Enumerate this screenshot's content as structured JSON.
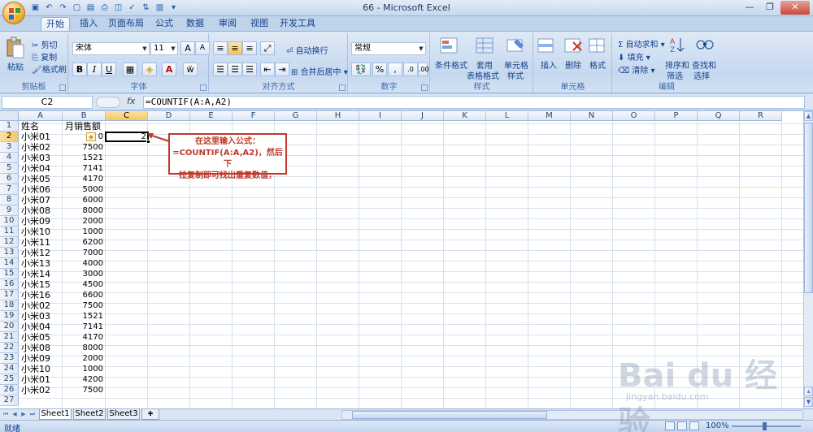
{
  "window": {
    "title": "66 - Microsoft Excel"
  },
  "ribbon_tabs": [
    "开始",
    "插入",
    "页面布局",
    "公式",
    "数据",
    "审阅",
    "视图",
    "开发工具"
  ],
  "clipboard": {
    "paste": "粘贴",
    "cut": "剪切",
    "copy": "复制",
    "format_painter": "格式刷",
    "label": "剪贴板"
  },
  "font": {
    "name": "宋体",
    "size": "11",
    "label": "字体",
    "bold": "B",
    "italic": "I",
    "underline": "U",
    "grow": "A",
    "shrink": "A"
  },
  "alignment": {
    "wrap": "自动换行",
    "merge": "合并后居中",
    "label": "对齐方式"
  },
  "number": {
    "format": "常规",
    "percent": "%",
    "comma": ",",
    "label": "数字"
  },
  "styles": {
    "conditional": "条件格式",
    "table_format_1": "套用",
    "table_format_2": "表格格式",
    "cell_styles_1": "单元格",
    "cell_styles_2": "样式",
    "label": "样式"
  },
  "cells": {
    "insert": "插入",
    "delete": "删除",
    "format": "格式",
    "label": "单元格"
  },
  "editing": {
    "autosum": "自动求和",
    "fill": "填充",
    "clear": "清除",
    "sort_1": "排序和",
    "sort_2": "筛选",
    "find_1": "查找和",
    "find_2": "选择",
    "label": "编辑"
  },
  "formula_bar": {
    "name_box": "C2",
    "fx": "fx",
    "formula": "=COUNTIF(A:A,A2)"
  },
  "columns": [
    "A",
    "B",
    "C",
    "D",
    "E",
    "F",
    "G",
    "H",
    "I",
    "J",
    "K",
    "L",
    "M",
    "N",
    "O",
    "P",
    "Q",
    "R"
  ],
  "header": {
    "a": "姓名",
    "b": "月销售额"
  },
  "rows": [
    {
      "n": "1"
    },
    {
      "n": "2",
      "a": "小米01",
      "b": "0"
    },
    {
      "n": "3",
      "a": "小米02",
      "b": "7500"
    },
    {
      "n": "4",
      "a": "小米03",
      "b": "1521"
    },
    {
      "n": "5",
      "a": "小米04",
      "b": "7141"
    },
    {
      "n": "6",
      "a": "小米05",
      "b": "4170"
    },
    {
      "n": "7",
      "a": "小米06",
      "b": "5000"
    },
    {
      "n": "8",
      "a": "小米07",
      "b": "6000"
    },
    {
      "n": "9",
      "a": "小米08",
      "b": "8000"
    },
    {
      "n": "10",
      "a": "小米09",
      "b": "2000"
    },
    {
      "n": "11",
      "a": "小米10",
      "b": "1000"
    },
    {
      "n": "12",
      "a": "小米11",
      "b": "6200"
    },
    {
      "n": "13",
      "a": "小米12",
      "b": "7000"
    },
    {
      "n": "14",
      "a": "小米13",
      "b": "4000"
    },
    {
      "n": "15",
      "a": "小米14",
      "b": "3000"
    },
    {
      "n": "16",
      "a": "小米15",
      "b": "4500"
    },
    {
      "n": "17",
      "a": "小米16",
      "b": "6600"
    },
    {
      "n": "18",
      "a": "小米02",
      "b": "7500"
    },
    {
      "n": "19",
      "a": "小米03",
      "b": "1521"
    },
    {
      "n": "20",
      "a": "小米04",
      "b": "7141"
    },
    {
      "n": "21",
      "a": "小米05",
      "b": "4170"
    },
    {
      "n": "22",
      "a": "小米08",
      "b": "8000"
    },
    {
      "n": "23",
      "a": "小米09",
      "b": "2000"
    },
    {
      "n": "24",
      "a": "小米10",
      "b": "1000"
    },
    {
      "n": "25",
      "a": "小米01",
      "b": "4200"
    },
    {
      "n": "26",
      "a": "小米02",
      "b": "7500"
    },
    {
      "n": "27"
    }
  ],
  "active_cell_value": "2",
  "callout": {
    "line1": "在这里输入公式：",
    "line2": "=COUNTIF(A:A,A2)，然后下",
    "line3": "拉复制即可找出重复数值，"
  },
  "sheet_tabs": [
    "Sheet1",
    "Sheet2",
    "Sheet3"
  ],
  "status": {
    "ready": "就绪",
    "zoom": "100%"
  },
  "watermark": {
    "main": "Bai du 经验",
    "sub": "jingyan.baidu.com"
  },
  "colors": {
    "accent": "#15428b",
    "callout_red": "#c0392b",
    "selection": "#f5c766"
  }
}
